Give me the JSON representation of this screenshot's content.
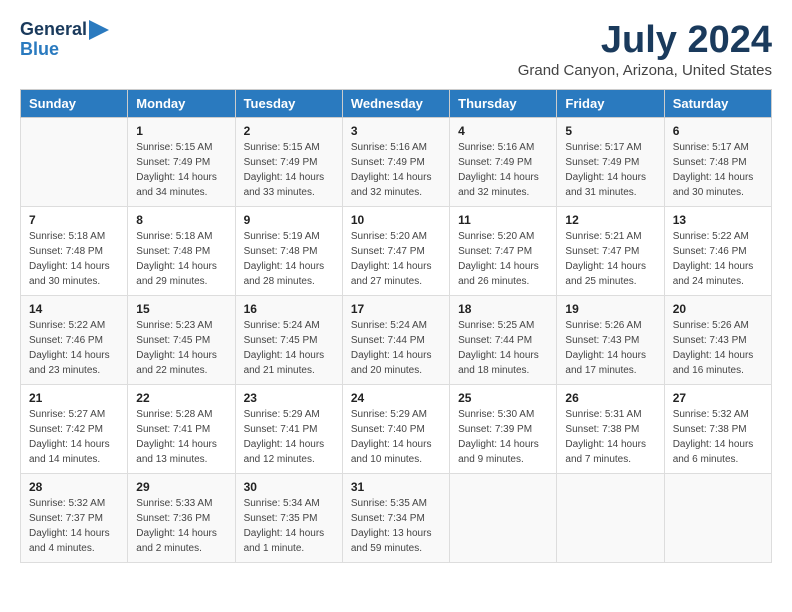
{
  "header": {
    "logo_line1": "General",
    "logo_line2": "Blue",
    "title": "July 2024",
    "subtitle": "Grand Canyon, Arizona, United States"
  },
  "days_of_week": [
    "Sunday",
    "Monday",
    "Tuesday",
    "Wednesday",
    "Thursday",
    "Friday",
    "Saturday"
  ],
  "weeks": [
    [
      {
        "day": "",
        "sunrise": "",
        "sunset": "",
        "daylight": ""
      },
      {
        "day": "1",
        "sunrise": "Sunrise: 5:15 AM",
        "sunset": "Sunset: 7:49 PM",
        "daylight": "Daylight: 14 hours and 34 minutes."
      },
      {
        "day": "2",
        "sunrise": "Sunrise: 5:15 AM",
        "sunset": "Sunset: 7:49 PM",
        "daylight": "Daylight: 14 hours and 33 minutes."
      },
      {
        "day": "3",
        "sunrise": "Sunrise: 5:16 AM",
        "sunset": "Sunset: 7:49 PM",
        "daylight": "Daylight: 14 hours and 32 minutes."
      },
      {
        "day": "4",
        "sunrise": "Sunrise: 5:16 AM",
        "sunset": "Sunset: 7:49 PM",
        "daylight": "Daylight: 14 hours and 32 minutes."
      },
      {
        "day": "5",
        "sunrise": "Sunrise: 5:17 AM",
        "sunset": "Sunset: 7:49 PM",
        "daylight": "Daylight: 14 hours and 31 minutes."
      },
      {
        "day": "6",
        "sunrise": "Sunrise: 5:17 AM",
        "sunset": "Sunset: 7:48 PM",
        "daylight": "Daylight: 14 hours and 30 minutes."
      }
    ],
    [
      {
        "day": "7",
        "sunrise": "Sunrise: 5:18 AM",
        "sunset": "Sunset: 7:48 PM",
        "daylight": "Daylight: 14 hours and 30 minutes."
      },
      {
        "day": "8",
        "sunrise": "Sunrise: 5:18 AM",
        "sunset": "Sunset: 7:48 PM",
        "daylight": "Daylight: 14 hours and 29 minutes."
      },
      {
        "day": "9",
        "sunrise": "Sunrise: 5:19 AM",
        "sunset": "Sunset: 7:48 PM",
        "daylight": "Daylight: 14 hours and 28 minutes."
      },
      {
        "day": "10",
        "sunrise": "Sunrise: 5:20 AM",
        "sunset": "Sunset: 7:47 PM",
        "daylight": "Daylight: 14 hours and 27 minutes."
      },
      {
        "day": "11",
        "sunrise": "Sunrise: 5:20 AM",
        "sunset": "Sunset: 7:47 PM",
        "daylight": "Daylight: 14 hours and 26 minutes."
      },
      {
        "day": "12",
        "sunrise": "Sunrise: 5:21 AM",
        "sunset": "Sunset: 7:47 PM",
        "daylight": "Daylight: 14 hours and 25 minutes."
      },
      {
        "day": "13",
        "sunrise": "Sunrise: 5:22 AM",
        "sunset": "Sunset: 7:46 PM",
        "daylight": "Daylight: 14 hours and 24 minutes."
      }
    ],
    [
      {
        "day": "14",
        "sunrise": "Sunrise: 5:22 AM",
        "sunset": "Sunset: 7:46 PM",
        "daylight": "Daylight: 14 hours and 23 minutes."
      },
      {
        "day": "15",
        "sunrise": "Sunrise: 5:23 AM",
        "sunset": "Sunset: 7:45 PM",
        "daylight": "Daylight: 14 hours and 22 minutes."
      },
      {
        "day": "16",
        "sunrise": "Sunrise: 5:24 AM",
        "sunset": "Sunset: 7:45 PM",
        "daylight": "Daylight: 14 hours and 21 minutes."
      },
      {
        "day": "17",
        "sunrise": "Sunrise: 5:24 AM",
        "sunset": "Sunset: 7:44 PM",
        "daylight": "Daylight: 14 hours and 20 minutes."
      },
      {
        "day": "18",
        "sunrise": "Sunrise: 5:25 AM",
        "sunset": "Sunset: 7:44 PM",
        "daylight": "Daylight: 14 hours and 18 minutes."
      },
      {
        "day": "19",
        "sunrise": "Sunrise: 5:26 AM",
        "sunset": "Sunset: 7:43 PM",
        "daylight": "Daylight: 14 hours and 17 minutes."
      },
      {
        "day": "20",
        "sunrise": "Sunrise: 5:26 AM",
        "sunset": "Sunset: 7:43 PM",
        "daylight": "Daylight: 14 hours and 16 minutes."
      }
    ],
    [
      {
        "day": "21",
        "sunrise": "Sunrise: 5:27 AM",
        "sunset": "Sunset: 7:42 PM",
        "daylight": "Daylight: 14 hours and 14 minutes."
      },
      {
        "day": "22",
        "sunrise": "Sunrise: 5:28 AM",
        "sunset": "Sunset: 7:41 PM",
        "daylight": "Daylight: 14 hours and 13 minutes."
      },
      {
        "day": "23",
        "sunrise": "Sunrise: 5:29 AM",
        "sunset": "Sunset: 7:41 PM",
        "daylight": "Daylight: 14 hours and 12 minutes."
      },
      {
        "day": "24",
        "sunrise": "Sunrise: 5:29 AM",
        "sunset": "Sunset: 7:40 PM",
        "daylight": "Daylight: 14 hours and 10 minutes."
      },
      {
        "day": "25",
        "sunrise": "Sunrise: 5:30 AM",
        "sunset": "Sunset: 7:39 PM",
        "daylight": "Daylight: 14 hours and 9 minutes."
      },
      {
        "day": "26",
        "sunrise": "Sunrise: 5:31 AM",
        "sunset": "Sunset: 7:38 PM",
        "daylight": "Daylight: 14 hours and 7 minutes."
      },
      {
        "day": "27",
        "sunrise": "Sunrise: 5:32 AM",
        "sunset": "Sunset: 7:38 PM",
        "daylight": "Daylight: 14 hours and 6 minutes."
      }
    ],
    [
      {
        "day": "28",
        "sunrise": "Sunrise: 5:32 AM",
        "sunset": "Sunset: 7:37 PM",
        "daylight": "Daylight: 14 hours and 4 minutes."
      },
      {
        "day": "29",
        "sunrise": "Sunrise: 5:33 AM",
        "sunset": "Sunset: 7:36 PM",
        "daylight": "Daylight: 14 hours and 2 minutes."
      },
      {
        "day": "30",
        "sunrise": "Sunrise: 5:34 AM",
        "sunset": "Sunset: 7:35 PM",
        "daylight": "Daylight: 14 hours and 1 minute."
      },
      {
        "day": "31",
        "sunrise": "Sunrise: 5:35 AM",
        "sunset": "Sunset: 7:34 PM",
        "daylight": "Daylight: 13 hours and 59 minutes."
      },
      {
        "day": "",
        "sunrise": "",
        "sunset": "",
        "daylight": ""
      },
      {
        "day": "",
        "sunrise": "",
        "sunset": "",
        "daylight": ""
      },
      {
        "day": "",
        "sunrise": "",
        "sunset": "",
        "daylight": ""
      }
    ]
  ]
}
